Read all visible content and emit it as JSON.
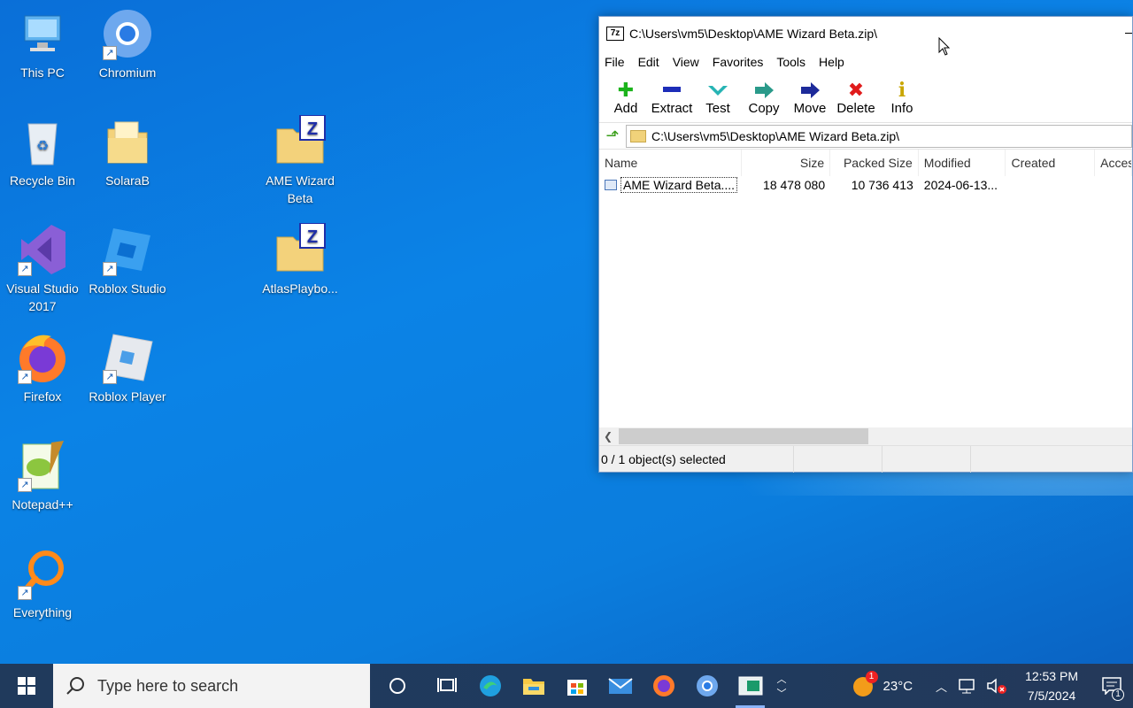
{
  "desktop": {
    "icons": [
      {
        "label": "This PC"
      },
      {
        "label": "Chromium"
      },
      {
        "label": "Recycle Bin"
      },
      {
        "label": "SolaraB"
      },
      {
        "label": "AME Wizard Beta"
      },
      {
        "label": "Visual Studio 2017"
      },
      {
        "label": "Roblox Studio"
      },
      {
        "label": "AtlasPlaybo..."
      },
      {
        "label": "Firefox"
      },
      {
        "label": "Roblox Player"
      },
      {
        "label": "Notepad++"
      },
      {
        "label": "Everything"
      }
    ]
  },
  "window": {
    "title": "C:\\Users\\vm5\\Desktop\\AME Wizard Beta.zip\\",
    "menu": [
      "File",
      "Edit",
      "View",
      "Favorites",
      "Tools",
      "Help"
    ],
    "toolbar": [
      "Add",
      "Extract",
      "Test",
      "Copy",
      "Move",
      "Delete",
      "Info"
    ],
    "address": "C:\\Users\\vm5\\Desktop\\AME Wizard Beta.zip\\",
    "columns": [
      "Name",
      "Size",
      "Packed Size",
      "Modified",
      "Created",
      "Acces"
    ],
    "rows": [
      {
        "name": "AME Wizard Beta....",
        "size": "18 478 080",
        "packed": "10 736 413",
        "modified": "2024-06-13...",
        "created": "",
        "accessed": ""
      }
    ],
    "status": "0 / 1 object(s) selected"
  },
  "taskbar": {
    "search_placeholder": "Type here to search",
    "weather": "23°C",
    "weather_badge": "1",
    "time": "12:53 PM",
    "date": "7/5/2024",
    "notification_badge": "1"
  }
}
